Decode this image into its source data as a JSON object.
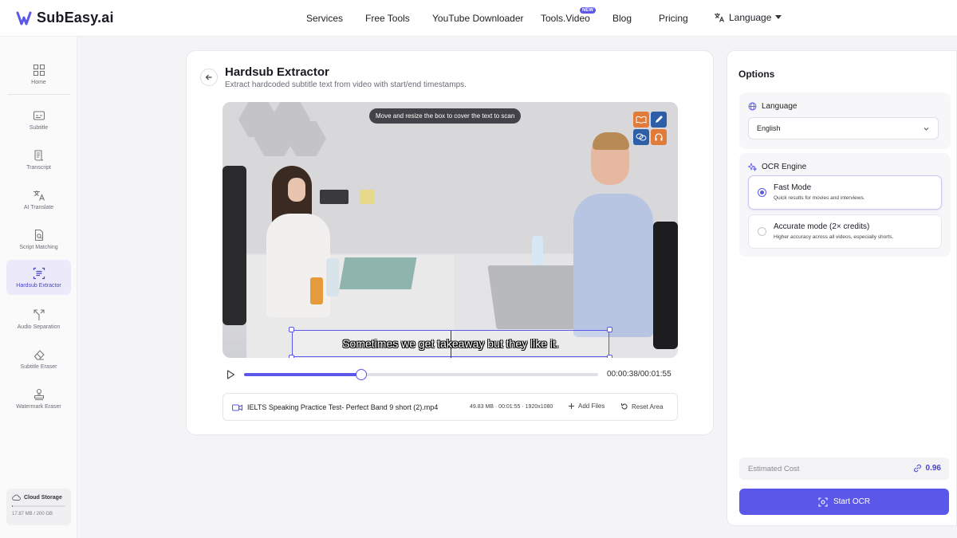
{
  "brand": {
    "name": "SubEasy.ai",
    "accent": "#5b57e8"
  },
  "nav": {
    "items": [
      "Services",
      "Free Tools",
      "YouTube Downloader",
      "Tools.Video",
      "Blog",
      "Pricing"
    ],
    "new_badge": "NEW",
    "language_label": "Language"
  },
  "sidebar": {
    "items": [
      {
        "label": "Home",
        "icon": "grid-icon"
      },
      {
        "label": "Subtitle",
        "icon": "subtitle-icon"
      },
      {
        "label": "Transcript",
        "icon": "transcript-icon"
      },
      {
        "label": "AI Translate",
        "icon": "translate-icon"
      },
      {
        "label": "Script Matching",
        "icon": "script-match-icon"
      },
      {
        "label": "Hardsub Extractor",
        "icon": "hardsub-icon",
        "active": true
      },
      {
        "label": "Audio Separation",
        "icon": "split-icon"
      },
      {
        "label": "Subtitle Eraser",
        "icon": "eraser-icon"
      },
      {
        "label": "Watermark Eraser",
        "icon": "stamp-icon"
      }
    ],
    "storage": {
      "title": "Cloud Storage",
      "usage": "17.87 MB / 200 GB",
      "fraction": 0.0001
    }
  },
  "main": {
    "title": "Hardsub Extractor",
    "subtitle": "Extract hardcoded subtitle text from video with start/end timestamps.",
    "video": {
      "tooltip": "Move and resize the box to cover the text to scan",
      "subtitle_text": "Sometimes we get takeaway but they like it."
    },
    "player": {
      "time": "00:00:38/00:01:55",
      "progress": 0.33
    },
    "file": {
      "name": "IELTS Speaking Practice Test- Perfect Band 9 short (2).mp4",
      "meta": "49.83 MB · 00:01:55 · 1920x1080",
      "add_label": "Add Files",
      "reset_label": "Reset Area"
    }
  },
  "options": {
    "title": "Options",
    "language": {
      "label": "Language",
      "value": "English"
    },
    "ocr": {
      "label": "OCR Engine",
      "modes": [
        {
          "title": "Fast Mode",
          "desc": "Quick results for movies and interviews.",
          "selected": true
        },
        {
          "title": "Accurate mode (2× credits)",
          "desc": "Higher accuracy across all videos, especially shorts.",
          "selected": false
        }
      ]
    },
    "cost": {
      "label": "Estimated Cost",
      "value": "0.96"
    },
    "start_label": "Start OCR"
  }
}
